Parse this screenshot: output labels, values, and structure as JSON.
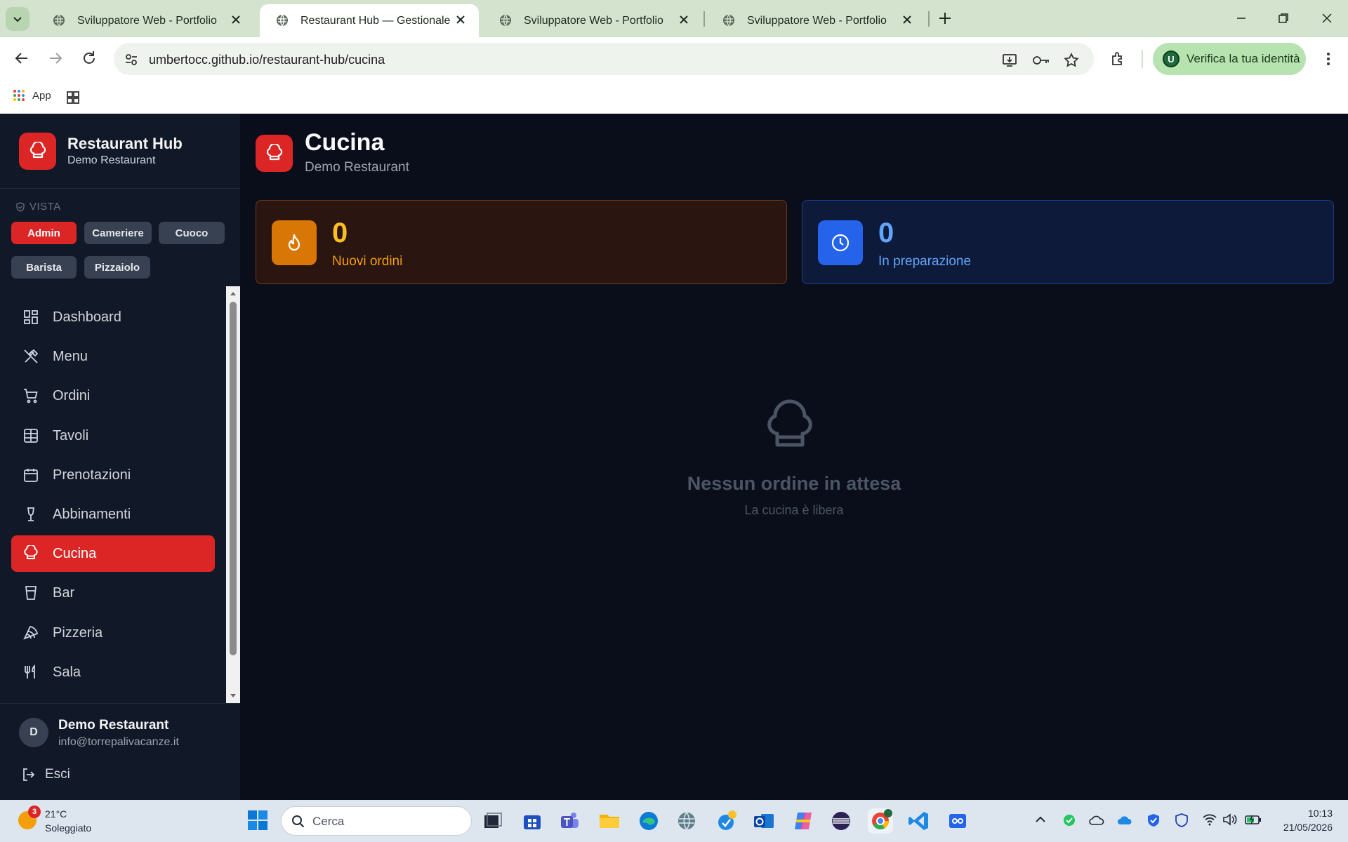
{
  "browser": {
    "tabs": [
      {
        "title": "Sviluppatore Web - Portfolio"
      },
      {
        "title": "Restaurant Hub — Gestionale"
      },
      {
        "title": "Sviluppatore Web - Portfolio"
      },
      {
        "title": "Sviluppatore Web - Portfolio"
      }
    ],
    "url": "umbertocc.github.io/restaurant-hub/cucina",
    "profile_initial": "U",
    "verify_label": "Verifica la tua identità",
    "bookmarks": {
      "apps_label": "App"
    }
  },
  "sidebar": {
    "brand_title": "Restaurant Hub",
    "brand_subtitle": "Demo Restaurant",
    "view_label": "VISTA",
    "roles": [
      "Admin",
      "Cameriere",
      "Cuoco",
      "Barista",
      "Pizzaiolo"
    ],
    "active_role": "Admin",
    "nav": [
      {
        "label": "Dashboard",
        "icon": "dashboard-icon"
      },
      {
        "label": "Menu",
        "icon": "utensils-crossed-icon"
      },
      {
        "label": "Ordini",
        "icon": "cart-icon"
      },
      {
        "label": "Tavoli",
        "icon": "table-grid-icon"
      },
      {
        "label": "Prenotazioni",
        "icon": "calendar-icon"
      },
      {
        "label": "Abbinamenti",
        "icon": "wine-icon"
      },
      {
        "label": "Cucina",
        "icon": "chef-hat-icon"
      },
      {
        "label": "Bar",
        "icon": "cup-icon"
      },
      {
        "label": "Pizzeria",
        "icon": "pizza-icon"
      },
      {
        "label": "Sala",
        "icon": "fork-knife-icon"
      }
    ],
    "active_nav": "Cucina",
    "user": {
      "initial": "D",
      "name": "Demo Restaurant",
      "email": "info@torrepalivacanze.it"
    },
    "logout_label": "Esci"
  },
  "page": {
    "title": "Cucina",
    "subtitle": "Demo Restaurant",
    "stats": {
      "new_orders": {
        "value": "0",
        "label": "Nuovi ordini"
      },
      "in_preparation": {
        "value": "0",
        "label": "In preparazione"
      }
    },
    "empty": {
      "title": "Nessun ordine in attesa",
      "subtitle": "La cucina è libera"
    }
  },
  "taskbar": {
    "weather_badge": "3",
    "temperature": "21°C",
    "condition": "Soleggiato",
    "search_placeholder": "Cerca",
    "time": "10:13",
    "date": "21/05/2026"
  },
  "colors": {
    "accent_red": "#dc2626",
    "sidebar_bg": "#111827",
    "main_bg": "#0a0e1a",
    "new_orders_accent": "#d97706",
    "prep_accent": "#2563eb"
  }
}
